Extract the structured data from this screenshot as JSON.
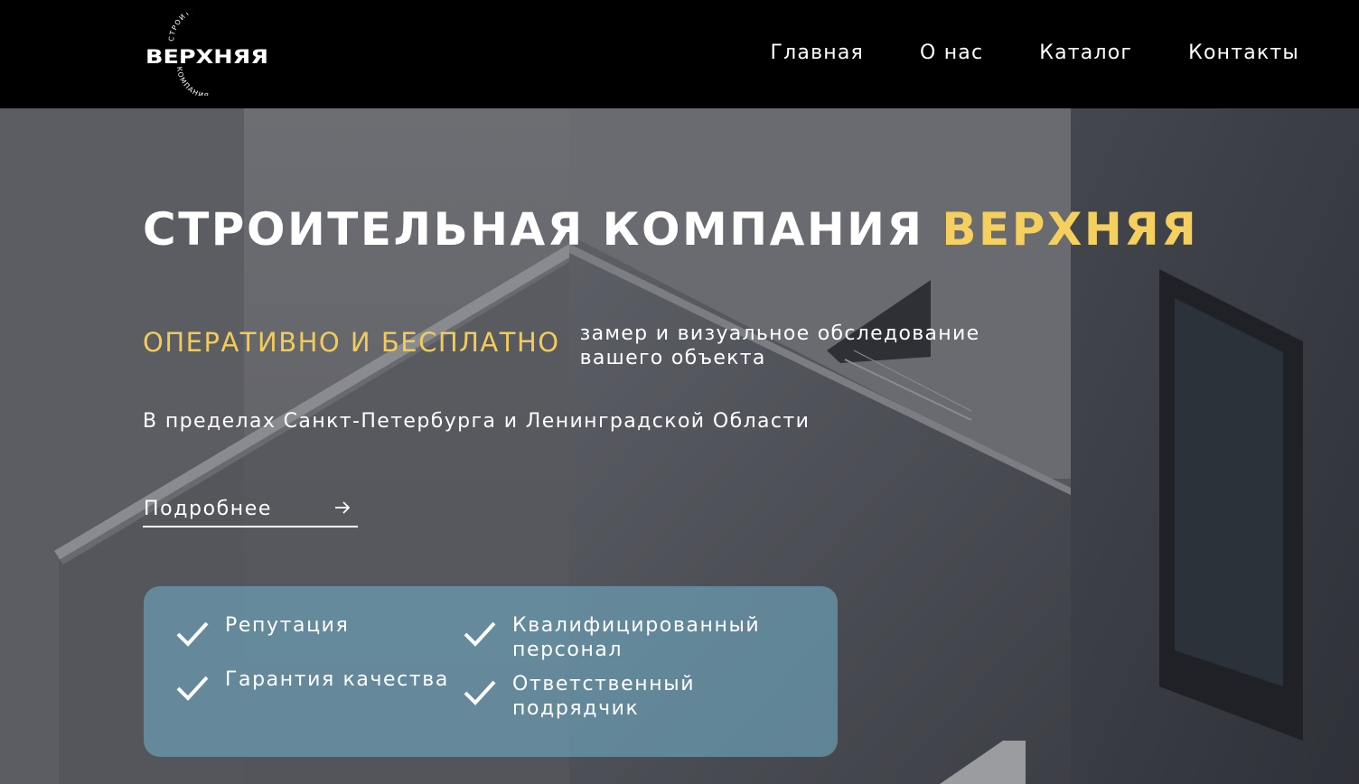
{
  "header": {
    "logo": {
      "word": "ВЕРХНЯЯ",
      "arc_top": "СТРОИТЕЛЬНАЯ",
      "arc_bottom": "КОМПАНИЯ"
    },
    "nav": [
      {
        "label": "Главная"
      },
      {
        "label": "О нас"
      },
      {
        "label": "Каталог"
      },
      {
        "label": "Контакты"
      }
    ]
  },
  "hero": {
    "title_main": "СТРОИТЕЛЬНАЯ КОМПАНИЯ ",
    "title_accent": "ВЕРХНЯЯ",
    "highlight": "ОПЕРАТИВНО И БЕСПЛАТНО",
    "highlight_desc": "замер и визуальное обследование вашего объекта",
    "region": "В пределах Санкт-Петербурга и Ленинградской Области",
    "more_label": "Подробнее",
    "features": [
      {
        "label": "Репутация"
      },
      {
        "label": "Квалифицированный персонал"
      },
      {
        "label": "Гарантия качества"
      },
      {
        "label": "Ответственный подрядчик"
      }
    ]
  },
  "colors": {
    "accent_yellow": "#f5d05e",
    "header_bg": "#000000",
    "features_panel": "#70aac2"
  }
}
